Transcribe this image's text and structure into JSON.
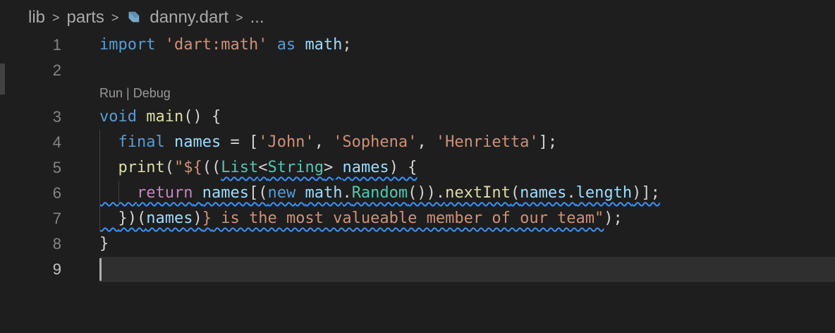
{
  "breadcrumb": {
    "items": [
      "lib",
      "parts",
      "danny.dart",
      "..."
    ],
    "separator": ">"
  },
  "codelens": {
    "run": "Run",
    "divider": " | ",
    "debug": "Debug"
  },
  "line_numbers": [
    "1",
    "2",
    "3",
    "4",
    "5",
    "6",
    "7",
    "8",
    "9"
  ],
  "code": {
    "l1": {
      "import": "import",
      "sp1": " ",
      "uri": "'dart:math'",
      "sp2": " ",
      "as": "as",
      "sp3": " ",
      "alias": "math",
      "semi": ";"
    },
    "l3": {
      "void": "void",
      "sp1": " ",
      "main": "main",
      "parens": "() {"
    },
    "l4": {
      "ind": "  ",
      "final": "final",
      "sp1": " ",
      "names": "names",
      "eq": " = [",
      "s1": "'John'",
      "c1": ", ",
      "s2": "'Sophena'",
      "c2": ", ",
      "s3": "'Henrietta'",
      "end": "];"
    },
    "l5": {
      "ind": "  ",
      "print": "print",
      "p1": "(",
      "q": "\"${",
      "p2": "((",
      "List": "List",
      "lt": "<",
      "String": "String",
      "gt": ">",
      "sp": " ",
      "names": "names",
      "end": ") {"
    },
    "l6": {
      "ind": "    ",
      "return": "return",
      "sp1": " ",
      "names": "names",
      "b1": "[(",
      "new": "new",
      "sp2": " ",
      "math": "math",
      "dot1": ".",
      "Random": "Random",
      "p1": "()).",
      "nextInt": "nextInt",
      "p2": "(",
      "names2": "names",
      "dot2": ".",
      "length": "length",
      "end": ")];"
    },
    "l7": {
      "ind": "  ",
      "close": "})(",
      "names": "names",
      "p": ")",
      "brace": "}",
      "rest": " is the most valueable member of our team\"",
      "end": ");"
    },
    "l8": {
      "brace": "}"
    }
  },
  "colors": {
    "keyword": "#569cd6",
    "control": "#c586c0",
    "string": "#ce9178",
    "variable": "#9cdcfe",
    "function": "#dcdcaa",
    "type": "#4ec9b0",
    "squiggle": "#3794ff",
    "background": "#1e1e1e"
  },
  "icons": {
    "file": "dart-file-icon"
  }
}
